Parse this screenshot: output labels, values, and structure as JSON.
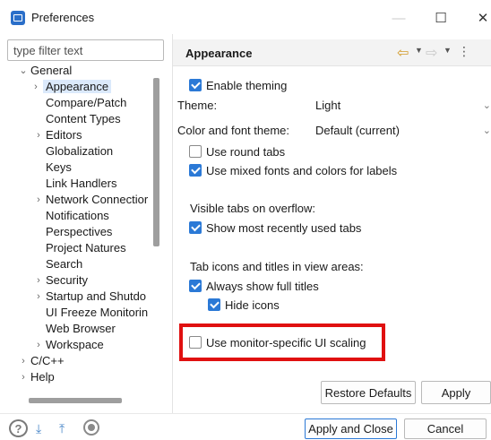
{
  "window": {
    "title": "Preferences",
    "minimize_glyph": "—",
    "maximize_glyph": "☐",
    "close_glyph": "✕"
  },
  "filter": {
    "placeholder": "type filter text"
  },
  "tree": {
    "items": [
      {
        "label": "General",
        "chevron": "⌄"
      },
      {
        "label": "Appearance",
        "chevron": "›"
      },
      {
        "label": "Compare/Patch"
      },
      {
        "label": "Content Types"
      },
      {
        "label": "Editors",
        "chevron": "›"
      },
      {
        "label": "Globalization"
      },
      {
        "label": "Keys"
      },
      {
        "label": "Link Handlers"
      },
      {
        "label": "Network Connectior",
        "chevron": "›"
      },
      {
        "label": "Notifications"
      },
      {
        "label": "Perspectives"
      },
      {
        "label": "Project Natures"
      },
      {
        "label": "Search"
      },
      {
        "label": "Security",
        "chevron": "›"
      },
      {
        "label": "Startup and Shutdo",
        "chevron": "›"
      },
      {
        "label": "UI Freeze Monitorin"
      },
      {
        "label": "Web Browser"
      },
      {
        "label": "Workspace",
        "chevron": "›"
      },
      {
        "label": "C/C++",
        "chevron": "›"
      },
      {
        "label": "Help",
        "chevron": "›"
      }
    ]
  },
  "page": {
    "title": "Appearance",
    "nav_back": "⇦",
    "nav_back_dropdown": "▼",
    "nav_forward": "⇨",
    "nav_forward_dropdown": "▼",
    "nav_more": "⋮"
  },
  "settings": {
    "enable_theming": {
      "label": "Enable theming",
      "checked": true
    },
    "theme": {
      "label": "Theme:",
      "value": "Light"
    },
    "color_font_theme": {
      "label": "Color and font theme:",
      "value": "Default (current)"
    },
    "round_tabs": {
      "label": "Use round tabs",
      "checked": false
    },
    "mixed_fonts": {
      "label": "Use mixed fonts and colors for labels",
      "checked": true
    },
    "visible_tabs_section": "Visible tabs on overflow:",
    "show_recent_tabs": {
      "label": "Show most recently used tabs",
      "checked": true
    },
    "tab_icons_section": "Tab icons and titles in view areas:",
    "always_full_titles": {
      "label": "Always show full titles",
      "checked": true
    },
    "hide_icons": {
      "label": "Hide icons",
      "checked": true
    },
    "monitor_scaling": {
      "label": "Use monitor-specific UI scaling",
      "checked": false
    },
    "combo_arrow": "⌄"
  },
  "buttons": {
    "restore_defaults": "Restore Defaults",
    "apply": "Apply",
    "apply_and_close": "Apply and Close",
    "cancel": "Cancel"
  },
  "footer": {
    "help_glyph": "?",
    "import_glyph": "⤓",
    "export_glyph": "⤒"
  },
  "colors": {
    "accent": "#2b79d6",
    "highlight_box": "#e01010",
    "selection": "#dbe9fb",
    "nav_back": "#d39b2a"
  }
}
